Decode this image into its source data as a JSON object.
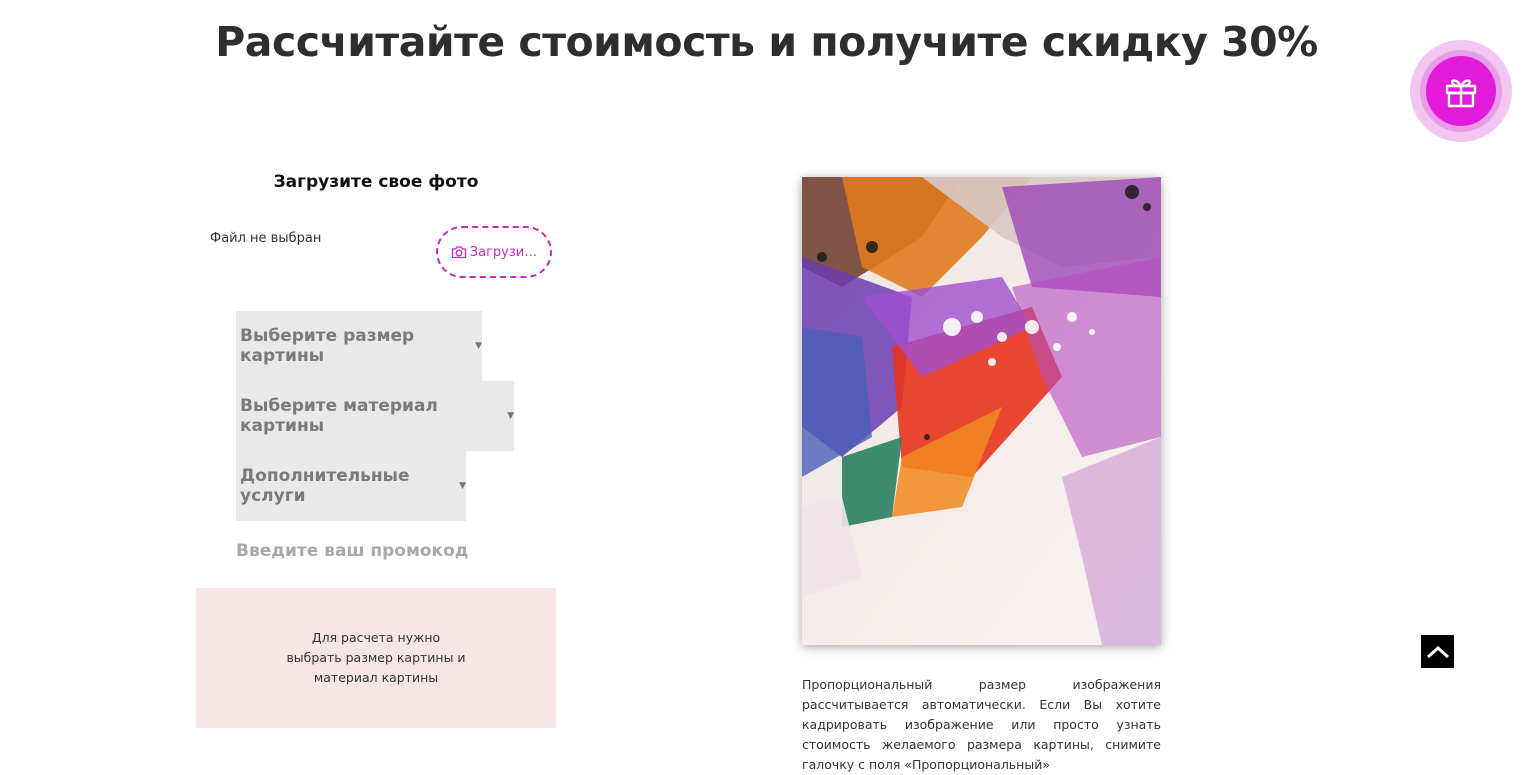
{
  "header": {
    "title": "Рассчитайте стоимость и получите скидку 30%"
  },
  "upload": {
    "title": "Загрузите свое фото",
    "file_status": "Файл не выбран",
    "button_label": "Загрузи…"
  },
  "form": {
    "size_select": "Выберите размер картины",
    "material_select": "Выберите материал картины",
    "services_select": "Дополнительные услуги",
    "promo_placeholder": "Введите ваш промокод"
  },
  "calc": {
    "message": "Для расчета нужно выбрать размер картины и материал картины"
  },
  "preview": {
    "note": "Пропорциональный размер изображения рассчитывается автоматически. Если Вы хотите кадрировать изображение или просто узнать стоимость желаемого размера картины, снимите галочку с поля «Пропорциональный»"
  },
  "icons": {
    "gift": "gift-icon",
    "camera": "camera-icon",
    "scroll_top": "chevron-up-icon",
    "dropdown": "caret-down-icon"
  },
  "colors": {
    "accent": "#e31ad9",
    "accent_dashed": "#c62abd",
    "select_bg": "#e9e9e9",
    "calc_bg": "#f6e6e6"
  }
}
